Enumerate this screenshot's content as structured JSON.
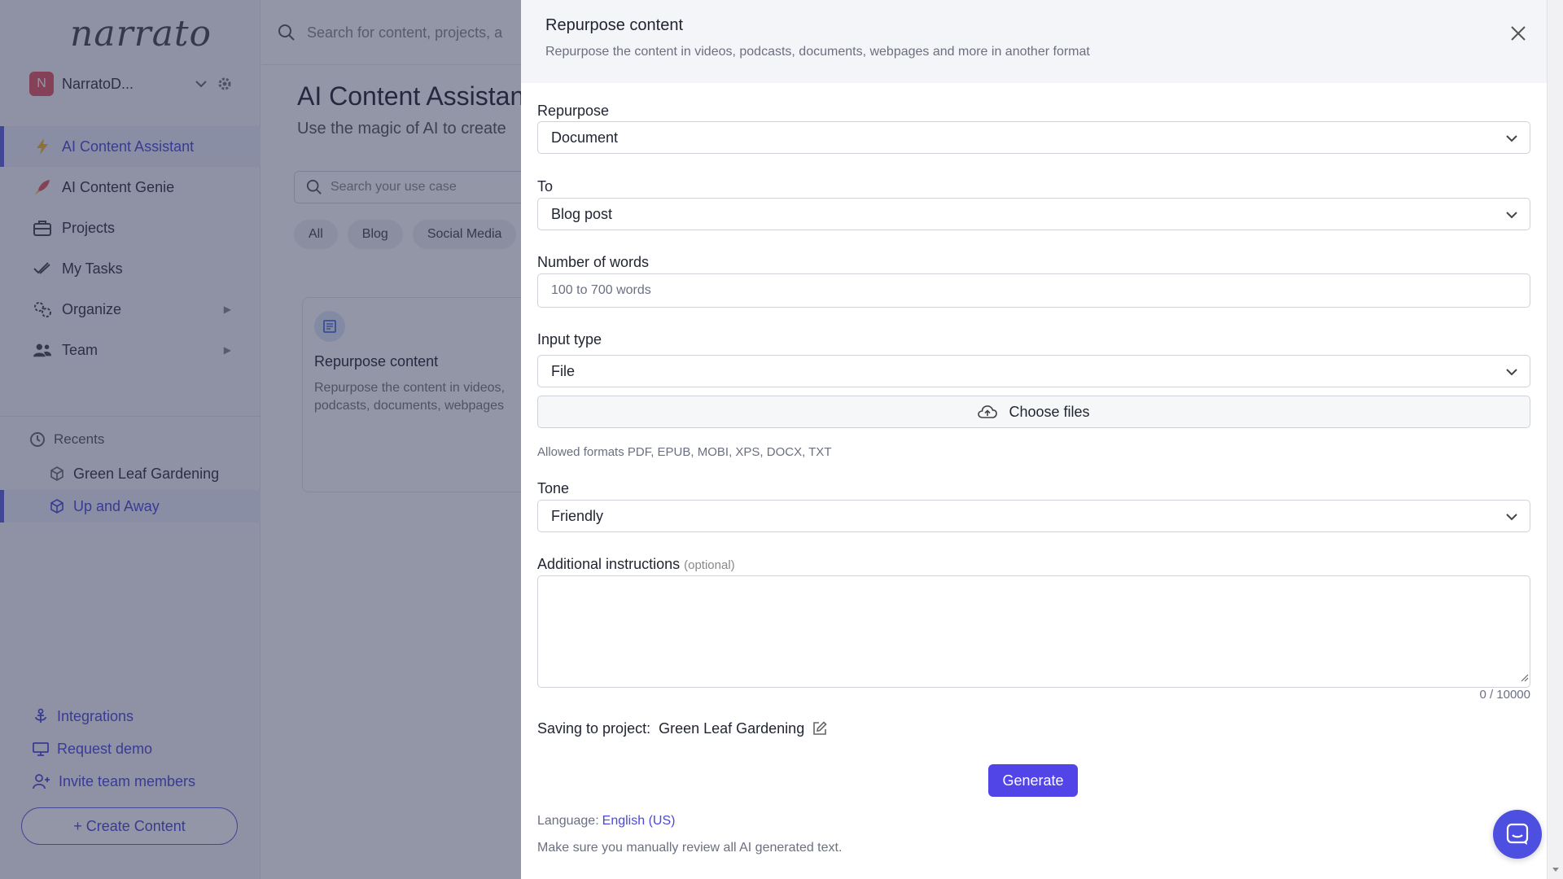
{
  "sidebar": {
    "logo": "narrato",
    "workspace": {
      "initial": "N",
      "name": "NarratoD..."
    },
    "nav": [
      {
        "label": "AI Content Assistant",
        "icon": "lightning-icon"
      },
      {
        "label": "AI Content Genie",
        "icon": "rocket-icon"
      },
      {
        "label": "Projects",
        "icon": "briefcase-icon"
      },
      {
        "label": "My Tasks",
        "icon": "double-check-icon"
      },
      {
        "label": "Organize",
        "icon": "gears-icon"
      },
      {
        "label": "Team",
        "icon": "people-icon"
      }
    ],
    "recents_title": "Recents",
    "recents": [
      "Green Leaf Gardening",
      "Up and Away"
    ],
    "bottom_links": [
      {
        "label": "Integrations",
        "icon": "anchor-icon"
      },
      {
        "label": "Request demo",
        "icon": "monitor-icon"
      },
      {
        "label": "Invite team members",
        "icon": "user-plus-icon"
      }
    ],
    "create_label": "+ Create Content"
  },
  "main": {
    "search_placeholder": "Search for content, projects, a",
    "title": "AI Content Assistant",
    "subtitle": "Use the magic of AI to create",
    "usecase_placeholder": "Search your use case",
    "chips": [
      "All",
      "Blog",
      "Social Media"
    ],
    "card": {
      "title": "Repurpose content",
      "desc": "Repurpose the content in videos, podcasts, documents, webpages"
    }
  },
  "panel": {
    "title": "Repurpose content",
    "subtitle": "Repurpose the content in videos, podcasts, documents, webpages and more in another format",
    "repurpose_label": "Repurpose",
    "repurpose_value": "Document",
    "to_label": "To",
    "to_value": "Blog post",
    "words_label": "Number of words",
    "words_placeholder": "100 to 700 words",
    "input_type_label": "Input type",
    "input_type_value": "File",
    "choose_files_label": "Choose files",
    "allowed_formats": "Allowed formats PDF, EPUB, MOBI, XPS, DOCX, TXT",
    "tone_label": "Tone",
    "tone_value": "Friendly",
    "instructions_label": "Additional instructions",
    "instructions_optional": "(optional)",
    "char_counter": "0 / 10000",
    "saving_label": "Saving to project:",
    "saving_project": "Green Leaf Gardening",
    "generate_label": "Generate",
    "language_label": "Language:",
    "language_value": "English (US)",
    "review_note": "Make sure you manually review all AI generated text."
  },
  "colors": {
    "accent": "#5145e8",
    "overlay": "#282e4e",
    "avatar": "#e05563"
  }
}
